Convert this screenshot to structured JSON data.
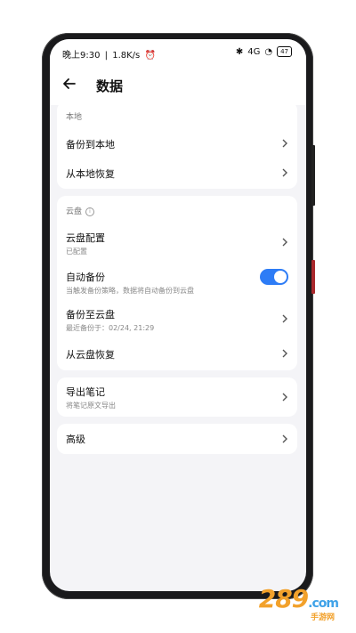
{
  "status": {
    "time": "晚上9:30",
    "speed": "1.8K/s",
    "signal": "4G",
    "battery": "47"
  },
  "header": {
    "title": "数据"
  },
  "local": {
    "section_title": "本地",
    "backup_local": "备份到本地",
    "restore_local": "从本地恢复"
  },
  "cloud": {
    "section_title": "云盘",
    "config_label": "云盘配置",
    "config_sub": "已配置",
    "auto_label": "自动备份",
    "auto_sub": "当触发备份策略，数据将自动备份到云盘",
    "auto_enabled": true,
    "backup_cloud": "备份至云盘",
    "backup_cloud_sub": "最近备份于：02/24, 21:29",
    "restore_cloud": "从云盘恢复"
  },
  "export": {
    "label": "导出笔记",
    "sub": "将笔记原文导出"
  },
  "advanced": {
    "label": "高级"
  },
  "watermark": {
    "brand": "289",
    "suffix": ".com",
    "tagline": "手游网"
  },
  "colors": {
    "accent": "#2d7cf6",
    "background": "#f4f4f7"
  }
}
